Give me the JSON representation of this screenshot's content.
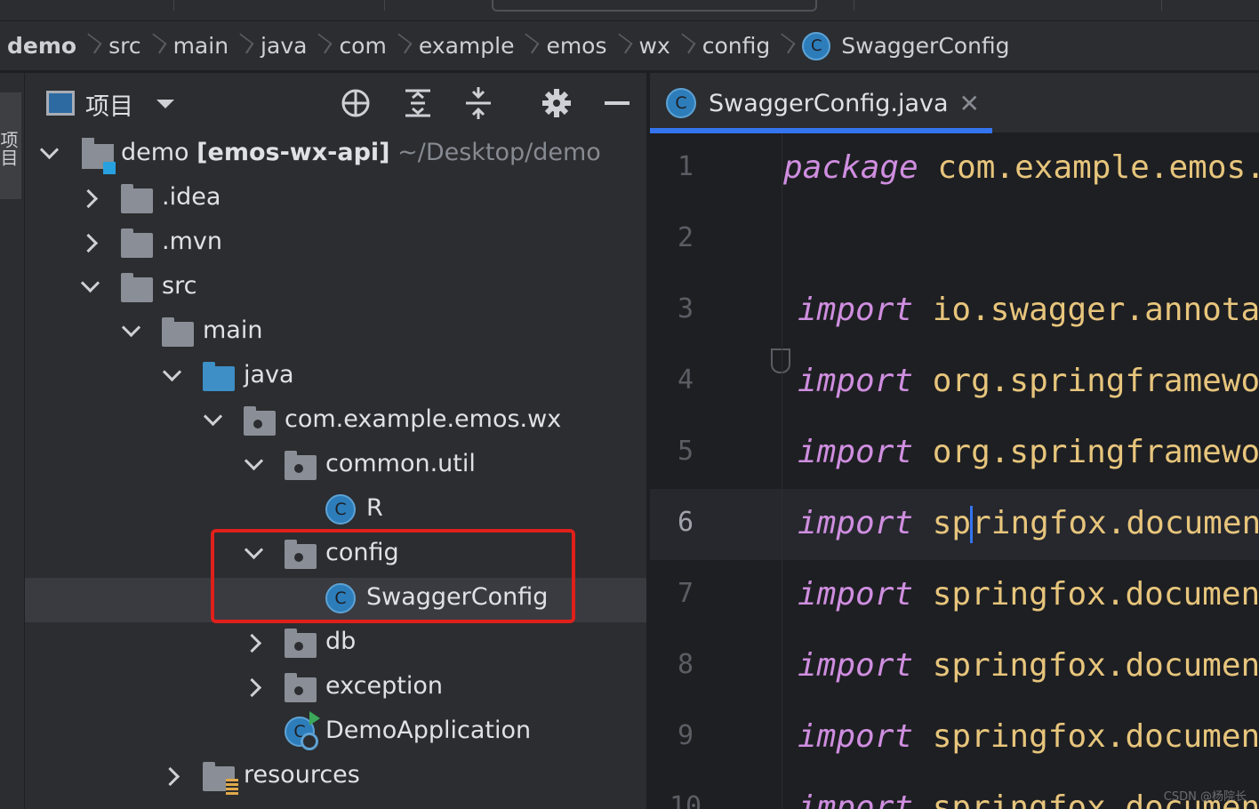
{
  "breadcrumb": {
    "items": [
      "demo",
      "src",
      "main",
      "java",
      "com",
      "example",
      "emos",
      "wx",
      "config",
      "SwaggerConfig"
    ],
    "class_badge": "C"
  },
  "left_rail": {
    "tab_label": "项目"
  },
  "project_panel": {
    "title": "项目",
    "header_icons": [
      "crosshair-icon",
      "expand-all-icon",
      "collapse-all-icon",
      "gear-icon",
      "minimize-icon"
    ],
    "tree": [
      {
        "label": "demo",
        "module": "[emos-wx-api]",
        "path": "~/Desktop/demo",
        "icon": "module-icon",
        "expanded": true
      },
      {
        "label": ".idea",
        "icon": "folder-icon",
        "expanded": false
      },
      {
        "label": ".mvn",
        "icon": "folder-icon",
        "expanded": false
      },
      {
        "label": "src",
        "icon": "folder-icon",
        "expanded": true
      },
      {
        "label": "main",
        "icon": "folder-icon",
        "expanded": true
      },
      {
        "label": "java",
        "icon": "source-folder-icon",
        "expanded": true
      },
      {
        "label": "com.example.emos.wx",
        "icon": "package-icon",
        "expanded": true
      },
      {
        "label": "common.util",
        "icon": "package-icon",
        "expanded": true
      },
      {
        "label": "R",
        "icon": "class-icon",
        "badge": "C"
      },
      {
        "label": "config",
        "icon": "package-icon",
        "expanded": true
      },
      {
        "label": "SwaggerConfig",
        "icon": "class-icon",
        "badge": "C",
        "selected": true
      },
      {
        "label": "db",
        "icon": "package-icon",
        "expanded": false
      },
      {
        "label": "exception",
        "icon": "package-icon",
        "expanded": false
      },
      {
        "label": "DemoApplication",
        "icon": "spring-app-icon",
        "badge": "C"
      },
      {
        "label": "resources",
        "icon": "resources-folder-icon",
        "expanded": false
      }
    ]
  },
  "editor": {
    "tab": {
      "label": "SwaggerConfig.java",
      "badge": "C",
      "close": "✕"
    },
    "lines": [
      {
        "n": "1",
        "kw": "package",
        "rest": "com.example.emos.wx"
      },
      {
        "n": "2",
        "kw": "",
        "rest": ""
      },
      {
        "n": "3",
        "kw": "import",
        "rest": "io.swagger.annotatio"
      },
      {
        "n": "4",
        "kw": "import",
        "rest": "org.springframework."
      },
      {
        "n": "5",
        "kw": "import",
        "rest": "org.springframework."
      },
      {
        "n": "6",
        "kw": "import",
        "rest_a": "sp",
        "rest_b": "ringfox.documentat",
        "current": true
      },
      {
        "n": "7",
        "kw": "import",
        "rest": "springfox.documentat"
      },
      {
        "n": "8",
        "kw": "import",
        "rest": "springfox.documentat"
      },
      {
        "n": "9",
        "kw": "import",
        "rest": "springfox.documentat"
      },
      {
        "n": "10",
        "kw": "import",
        "rest": "springfox.documentat"
      }
    ]
  },
  "watermark": "CSDN @杨院长",
  "colors": {
    "accent": "#3574f0",
    "highlight_box": "#e0201b",
    "keyword": "#cf8ee0",
    "package_text": "#e7c57c",
    "class_badge": "#2d7dbb"
  }
}
